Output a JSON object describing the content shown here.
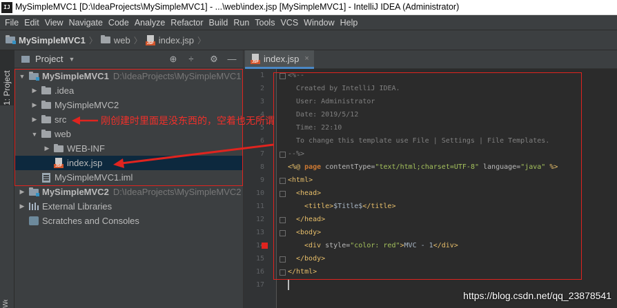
{
  "window": {
    "app_icon": "IJ",
    "title": "MySimpleMVC1 [D:\\IdeaProjects\\MySimpleMVC1] - ...\\web\\index.jsp [MySimpleMVC1] - IntelliJ IDEA (Administrator)"
  },
  "menu": [
    "File",
    "Edit",
    "View",
    "Navigate",
    "Code",
    "Analyze",
    "Refactor",
    "Build",
    "Run",
    "Tools",
    "VCS",
    "Window",
    "Help"
  ],
  "breadcrumb": {
    "project": "MySimpleMVC1",
    "folder": "web",
    "file": "index.jsp",
    "sep": "〉"
  },
  "left_strip": {
    "project_tab": "1: Project",
    "bottom_tab": "Web"
  },
  "project_panel": {
    "title": "Project",
    "tree": [
      {
        "label": "MySimpleMVC1",
        "path": "D:\\IdeaProjects\\MySimpleMVC1"
      },
      {
        "label": ".idea"
      },
      {
        "label": "MySimpleMVC2"
      },
      {
        "label": "src"
      },
      {
        "label": "web"
      },
      {
        "label": "WEB-INF"
      },
      {
        "label": "index.jsp"
      },
      {
        "label": "MySimpleMVC1.iml"
      },
      {
        "label": "MySimpleMVC2",
        "path": "D:\\IdeaProjects\\MySimpleMVC2"
      },
      {
        "label": "External Libraries"
      },
      {
        "label": "Scratches and Consoles"
      }
    ]
  },
  "annotation": {
    "text": "刚创建时里面是没东西的，空着也无所谓"
  },
  "editor": {
    "tab_label": "index.jsp",
    "tab_close": "×",
    "line_numbers": [
      "1",
      "2",
      "3",
      "4",
      "5",
      "6",
      "7",
      "8",
      "9",
      "10",
      "11",
      "12",
      "13",
      "14",
      "15",
      "16",
      "17"
    ],
    "lines": {
      "l1": "<%--",
      "l2": "  Created by IntelliJ IDEA.",
      "l3": "  User: Administrator",
      "l4": "  Date: 2019/5/12",
      "l5": "  Time: 22:10",
      "l6": "  To change this template use File | Settings | File Templates.",
      "l7": "--%>",
      "l8_open": "<%@ ",
      "l8_kw": "page",
      "l8_attr1": " contentType=",
      "l8_val1": "\"text/html;charset=UTF-8\"",
      "l8_attr2": " language=",
      "l8_val2": "\"java\"",
      "l8_close": " %>",
      "l9": "<html>",
      "l10": "<head>",
      "l11_open": "<title>",
      "l11_text": "$Title$",
      "l11_close": "</title>",
      "l12": "</head>",
      "l13": "<body>",
      "l14_open": "<div",
      "l14_attr": " style=",
      "l14_val": "\"color: red\"",
      "l14_gt": ">",
      "l14_text": "MVC - 1",
      "l14_close": "</div>",
      "l15": "</body>",
      "l16": "</html>"
    }
  },
  "watermark": "https://blog.csdn.net/qq_23878541",
  "colors": {
    "annotation_red": "#e0241f",
    "selection": "#0d293e",
    "accent_tab": "#4a88c7"
  },
  "icons": [
    "app-icon",
    "folder-icon",
    "module-folder-icon",
    "jsp-file-icon",
    "iml-file-icon",
    "library-icon",
    "scratch-icon",
    "globe-icon",
    "split-icon",
    "gear-icon",
    "minimize-icon",
    "breakpoint-icon"
  ]
}
